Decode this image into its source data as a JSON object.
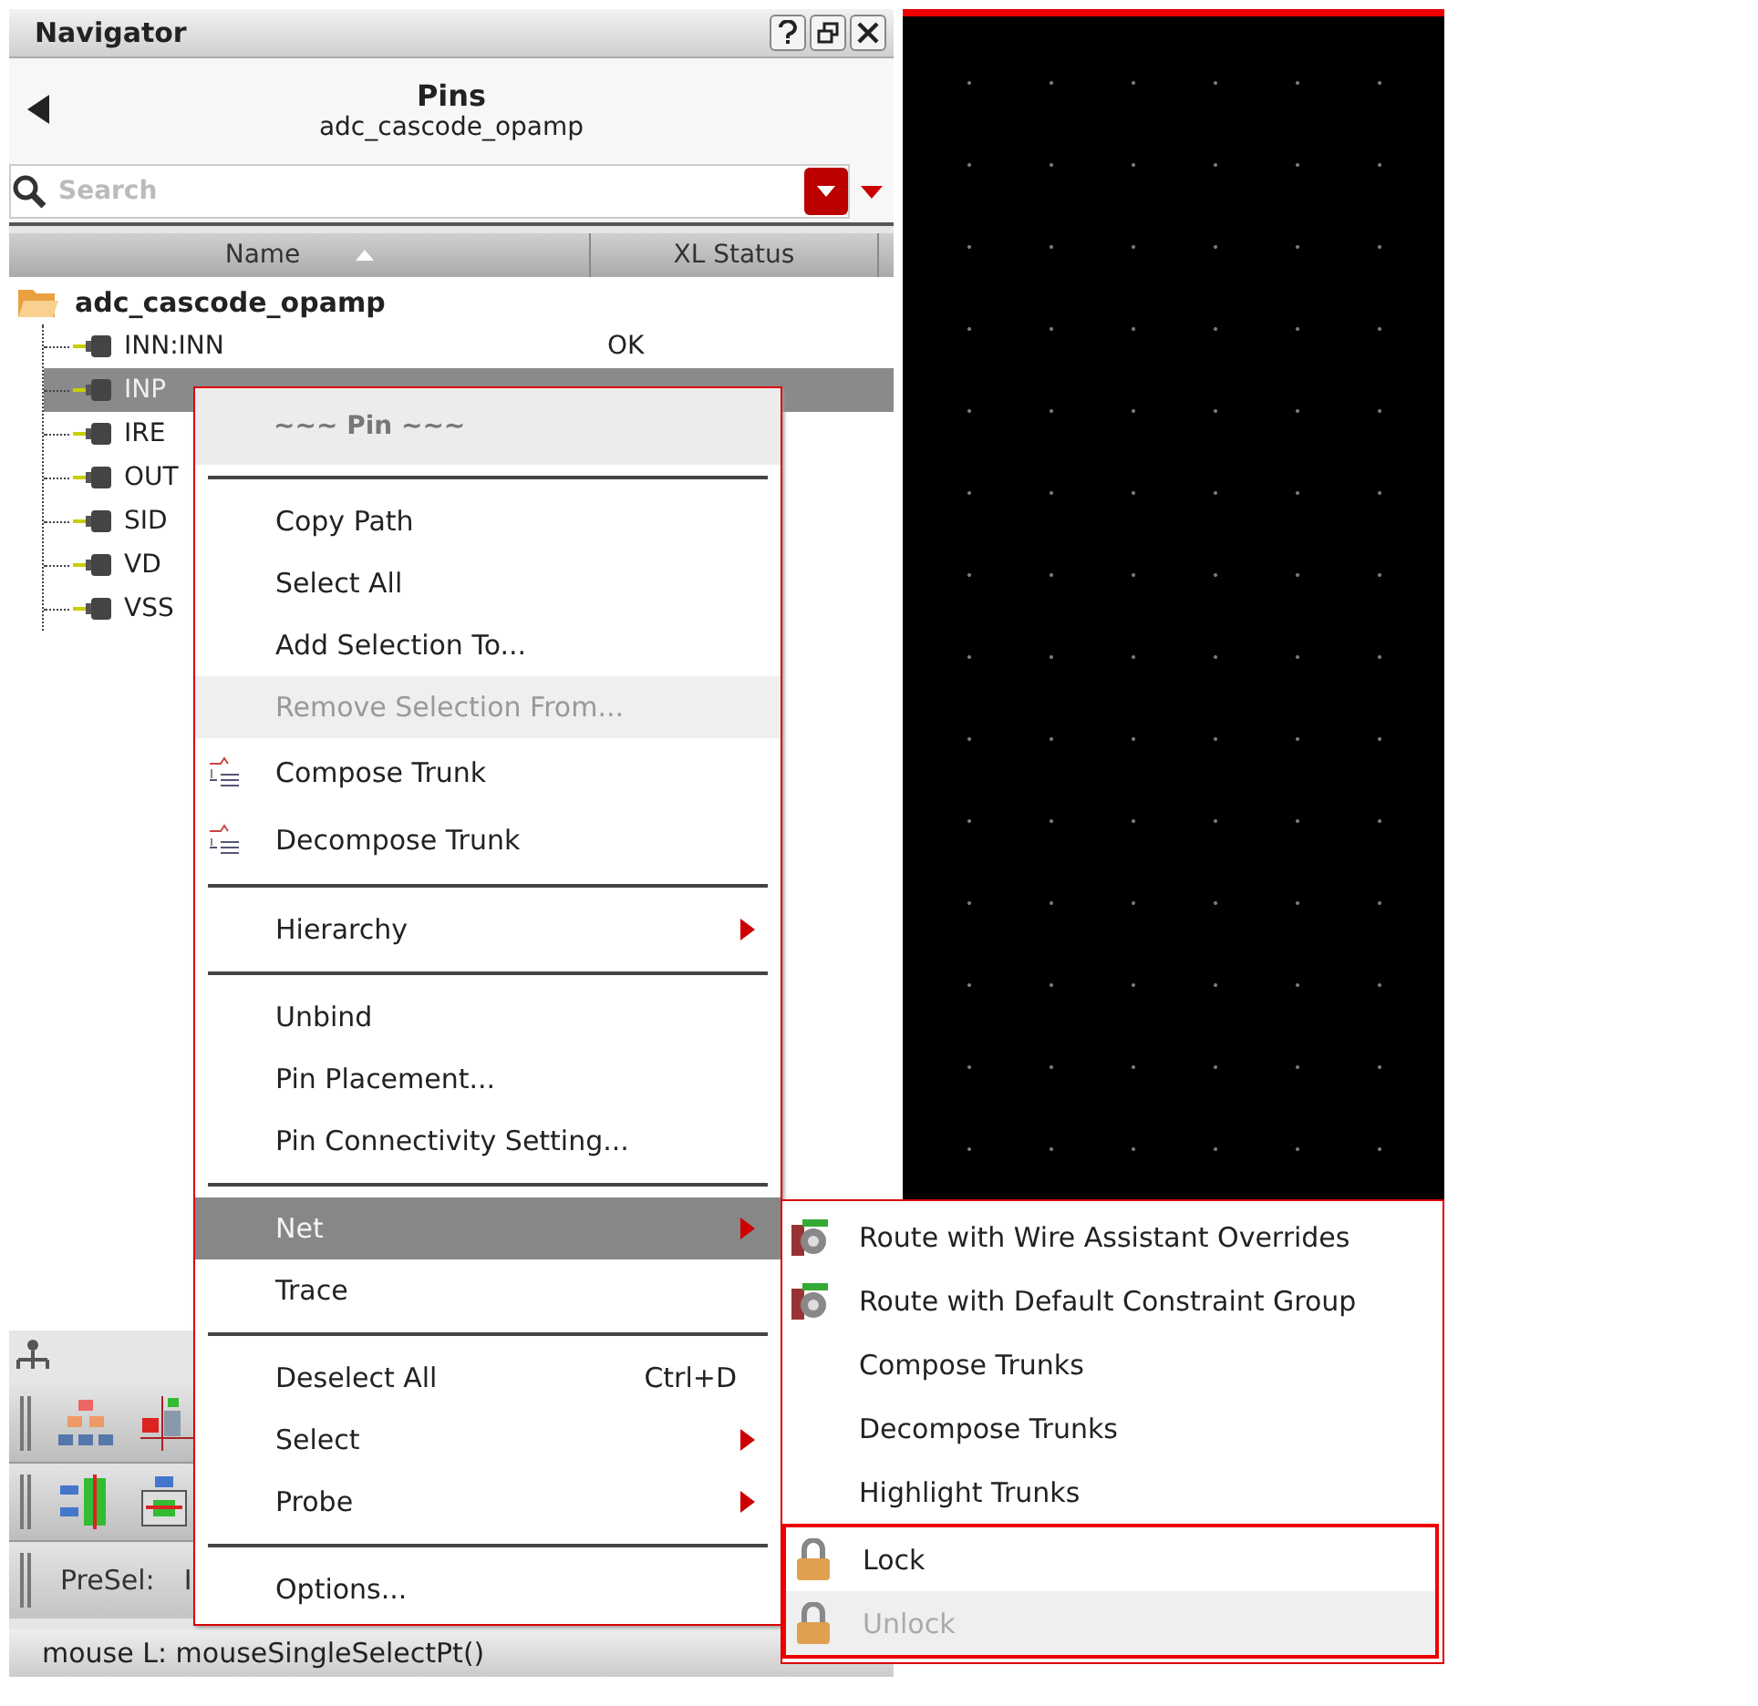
{
  "navigator": {
    "title": "Navigator"
  },
  "view": {
    "title": "Pins",
    "subtitle": "adc_cascode_opamp"
  },
  "search": {
    "placeholder": "Search"
  },
  "columns": [
    {
      "label": "Name",
      "sorted": true
    },
    {
      "label": "XL Status",
      "sorted": false
    }
  ],
  "tree": [
    {
      "name": "adc_cascode_opamp",
      "expanded": true,
      "children": [
        {
          "name": "INN:INN",
          "status": "OK",
          "selected": false
        },
        {
          "name": "INP",
          "selected": true
        },
        {
          "name": "IRE",
          "selected": false
        },
        {
          "name": "OUT",
          "selected": false
        },
        {
          "name": "SID",
          "selected": false
        },
        {
          "name": "VD",
          "selected": false
        },
        {
          "name": "VSS",
          "selected": false
        }
      ]
    }
  ],
  "presel": {
    "label": "PreSel:",
    "value": "I"
  },
  "status_bar": "mouse L: mouseSingleSelectPt()",
  "context_menu": {
    "items": [
      {
        "kind": "header",
        "label": "~~~ Pin ~~~"
      },
      {
        "kind": "separator"
      },
      {
        "kind": "item",
        "label": "Copy Path",
        "disabled": false,
        "selected": false
      },
      {
        "kind": "item",
        "label": "Select All",
        "disabled": false,
        "selected": false
      },
      {
        "kind": "item",
        "label": "Add Selection To...",
        "disabled": false,
        "selected": false
      },
      {
        "kind": "item",
        "label": "Remove Selection From...",
        "disabled": true,
        "selected": false
      },
      {
        "kind": "trunk_item",
        "label": "Compose Trunk",
        "disabled": false,
        "selected": false
      },
      {
        "kind": "trunk_item",
        "label": "Decompose Trunk",
        "disabled": false,
        "selected": false
      },
      {
        "kind": "separator"
      },
      {
        "kind": "item",
        "label": "Hierarchy",
        "submenu": true,
        "disabled": false,
        "selected": false
      },
      {
        "kind": "separator"
      },
      {
        "kind": "item",
        "label": "Unbind",
        "disabled": false,
        "selected": false
      },
      {
        "kind": "item",
        "label": "Pin Placement...",
        "disabled": false,
        "selected": false
      },
      {
        "kind": "item",
        "label": "Pin Connectivity Setting...",
        "disabled": false,
        "selected": false
      },
      {
        "kind": "separator"
      },
      {
        "kind": "item",
        "label": "Net",
        "submenu": true,
        "disabled": false,
        "selected": true
      },
      {
        "kind": "item",
        "label": "Trace",
        "disabled": false,
        "selected": false
      },
      {
        "kind": "separator"
      },
      {
        "kind": "item",
        "label": "Deselect All",
        "shortcut": "Ctrl+D",
        "disabled": false,
        "selected": false
      },
      {
        "kind": "item",
        "label": "Select",
        "submenu": true,
        "disabled": false,
        "selected": false
      },
      {
        "kind": "item",
        "label": "Probe",
        "submenu": true,
        "disabled": false,
        "selected": false
      },
      {
        "kind": "separator"
      },
      {
        "kind": "item",
        "label": "Options...",
        "disabled": false,
        "selected": false
      }
    ]
  },
  "submenu": {
    "items": [
      {
        "kind": "route",
        "label": "Route with Wire Assistant Overrides",
        "disabled": false,
        "boxed": false
      },
      {
        "kind": "route",
        "label": "Route with Default Constraint Group",
        "disabled": false,
        "boxed": false
      },
      {
        "kind": "plain",
        "label": "Compose Trunks",
        "disabled": false,
        "boxed": false
      },
      {
        "kind": "plain",
        "label": "Decompose Trunks",
        "disabled": false,
        "boxed": false
      },
      {
        "kind": "plain",
        "label": "Highlight Trunks",
        "disabled": false,
        "boxed": false
      },
      {
        "kind": "lock",
        "label": "Lock",
        "disabled": false,
        "boxed": true
      },
      {
        "kind": "lock",
        "label": "Unlock",
        "disabled": true,
        "boxed": true
      }
    ]
  }
}
